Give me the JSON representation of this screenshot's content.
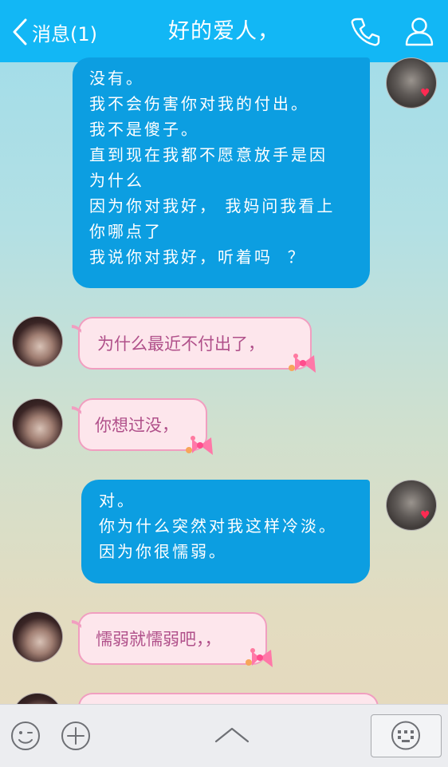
{
  "header": {
    "back_label": "消息(1)",
    "title": "好的爱人，",
    "bg_color": "#12b7f5"
  },
  "messages": [
    {
      "sender": "self",
      "lines": [
        "没有。",
        "我不会伤害你对我的付出。",
        "我不是傻子。",
        "直到现在我都不愿意放手是因",
        "为什么",
        "因为你对我好， 我妈问我看上",
        "你哪点了",
        "我说你对我好，听着吗  ？"
      ]
    },
    {
      "sender": "other",
      "text": "为什么最近不付出了，"
    },
    {
      "sender": "other",
      "text": "你想过没，"
    },
    {
      "sender": "self",
      "lines": [
        "对。",
        "你为什么突然对我这样冷淡。",
        "因为你很懦弱。"
      ]
    },
    {
      "sender": "other",
      "text": "懦弱就懦弱吧，，"
    }
  ],
  "bottombar": {
    "icons": [
      "emoji-icon",
      "plus-icon",
      "chevron-up-icon",
      "keyboard-icon"
    ]
  },
  "colors": {
    "self_bubble": "#0c9ee1",
    "other_bubble": "#fde6ec",
    "other_border": "#f19ec0",
    "other_text": "#b0508a"
  }
}
